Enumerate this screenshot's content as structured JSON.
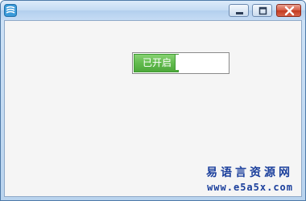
{
  "window": {
    "icon": "app-logo-icon",
    "controls": {
      "minimize": "minimize-icon",
      "maximize": "maximize-icon",
      "close": "close-icon"
    }
  },
  "switch": {
    "label": "已开启",
    "state": "on",
    "on_color": "#5cb84a"
  },
  "watermark": {
    "site_name": "易语言资源网",
    "url": "www.e5a5x.com",
    "color": "#1b3f9c"
  }
}
